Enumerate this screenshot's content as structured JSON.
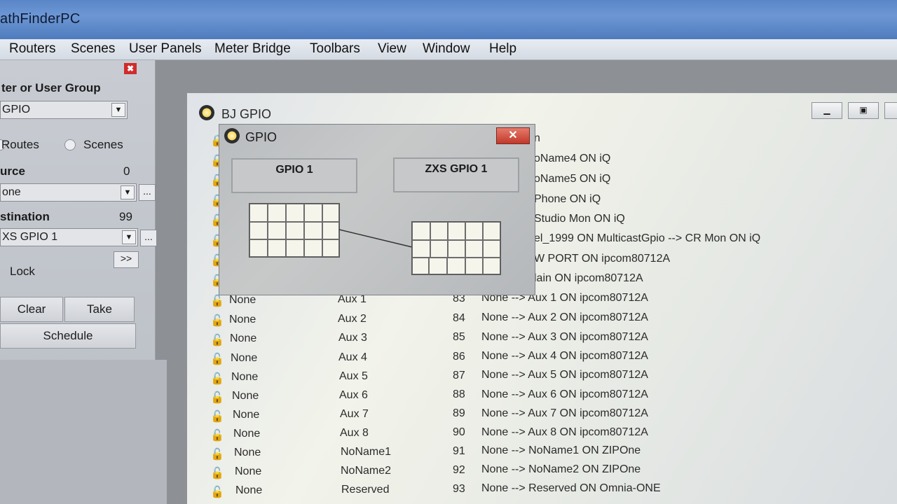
{
  "app": {
    "title": "athFinderPC"
  },
  "menu": [
    "Routers",
    "Scenes",
    "User Panels",
    "Meter Bridge",
    "Toolbars",
    "View",
    "Window",
    "Help"
  ],
  "left_panel": {
    "close_glyph": "✖",
    "filter_label": "ter or User Group",
    "filter_value": "GPIO",
    "radio_routes": "Routes",
    "radio_scenes": "Scenes",
    "source_label": "urce",
    "source_count": "0",
    "source_value": "one",
    "destination_label": "stination",
    "destination_count": "99",
    "destination_value": "XS GPIO 1",
    "more_button": "...",
    "forward_button": ">>",
    "lock_label": "Lock",
    "clear_button": "Clear",
    "take_button": "Take",
    "schedule_button": "Schedule"
  },
  "bj_window": {
    "title": "BJ GPIO",
    "header_fragment": "n",
    "top_rows": [
      "oName4 ON iQ",
      "oName5 ON iQ",
      "Phone ON iQ",
      "Studio Mon ON iQ",
      "el_1999 ON MulticastGpio --> CR Mon ON iQ",
      "W PORT ON ipcom80712A",
      "lain ON ipcom80712A"
    ],
    "rows": [
      {
        "source": "None",
        "name": "Aux 1",
        "num": "83",
        "route": "None --> Aux 1 ON ipcom80712A"
      },
      {
        "source": "None",
        "name": "Aux 2",
        "num": "84",
        "route": "None --> Aux 2 ON ipcom80712A"
      },
      {
        "source": "None",
        "name": "Aux 3",
        "num": "85",
        "route": "None --> Aux 3 ON ipcom80712A"
      },
      {
        "source": "None",
        "name": "Aux 4",
        "num": "86",
        "route": "None --> Aux 4 ON ipcom80712A"
      },
      {
        "source": "None",
        "name": "Aux 5",
        "num": "87",
        "route": "None --> Aux 5 ON ipcom80712A"
      },
      {
        "source": "None",
        "name": "Aux 6",
        "num": "88",
        "route": "None --> Aux 6 ON ipcom80712A"
      },
      {
        "source": "None",
        "name": "Aux 7",
        "num": "89",
        "route": "None --> Aux 7 ON ipcom80712A"
      },
      {
        "source": "None",
        "name": "Aux 8",
        "num": "90",
        "route": "None --> Aux 8 ON ipcom80712A"
      },
      {
        "source": "None",
        "name": "NoName1",
        "num": "91",
        "route": "None --> NoName1 ON ZIPOne"
      },
      {
        "source": "None",
        "name": "NoName2",
        "num": "92",
        "route": "None --> NoName2 ON ZIPOne"
      },
      {
        "source": "None",
        "name": "Reserved",
        "num": "93",
        "route": "None --> Reserved ON Omnia-ONE"
      }
    ]
  },
  "gpio_dialog": {
    "title": "GPIO",
    "close_glyph": "✕",
    "left_label": "GPIO 1",
    "right_label": "ZXS GPIO 1"
  }
}
